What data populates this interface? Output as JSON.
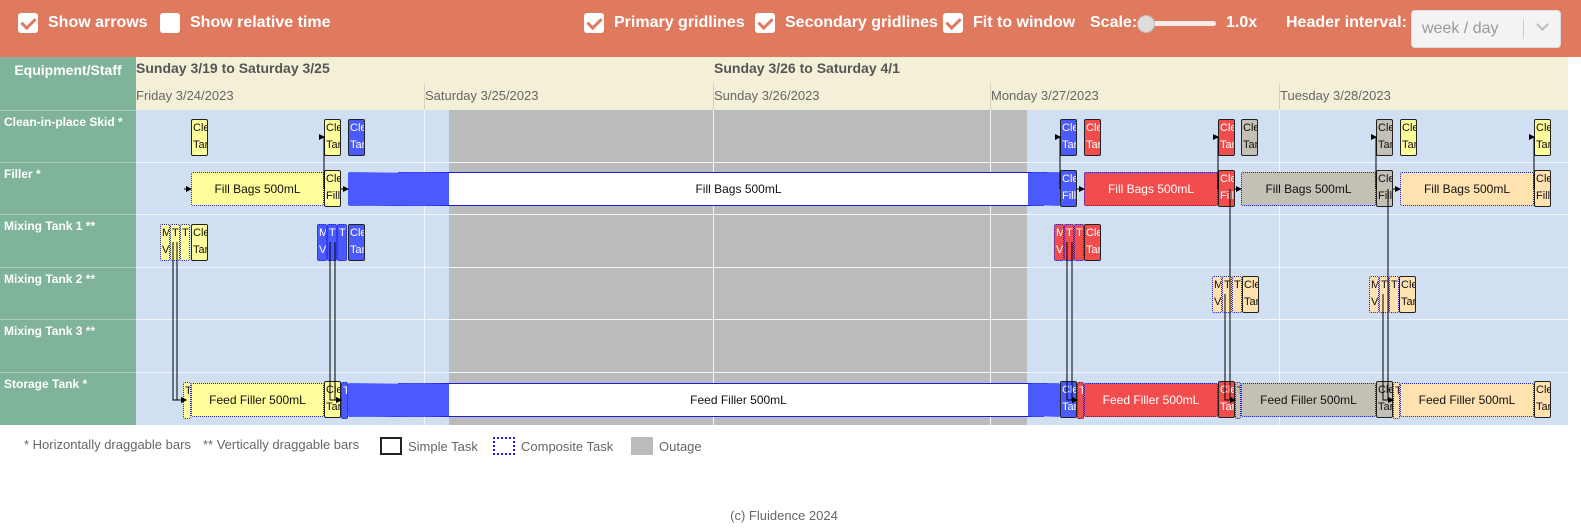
{
  "toolbar": {
    "show_arrows": {
      "label": "Show arrows",
      "checked": true
    },
    "show_relative_time": {
      "label": "Show relative time",
      "checked": false
    },
    "primary_gridlines": {
      "label": "Primary gridlines",
      "checked": true
    },
    "secondary_gridlines": {
      "label": "Secondary gridlines",
      "checked": true
    },
    "fit_to_window": {
      "label": "Fit to window",
      "checked": true
    },
    "scale_label": "Scale:",
    "scale_value": "1.0x",
    "header_interval_label": "Header interval:",
    "header_interval_value": "week / day"
  },
  "gantt": {
    "resource_header": "Equipment/Staff",
    "resources": [
      "Clean-in-place Skid *",
      "Filler *",
      "Mixing Tank 1 **",
      "Mixing Tank 2 **",
      "Mixing Tank 3 **",
      "Storage Tank *"
    ],
    "weeks": [
      "Sunday 3/19 to Saturday 3/25",
      "Sunday 3/26 to Saturday 4/1"
    ],
    "days": [
      "Friday 3/24/2023",
      "Saturday 3/25/2023",
      "Sunday 3/26/2023",
      "Monday 3/27/2023",
      "Tuesday 3/28/2023"
    ],
    "tasks": {
      "fill_bags": "Fill Bags 500mL",
      "feed_filler": "Feed Filler 500mL",
      "clean_tank": "Clean Tank",
      "clean_filler": "Clean Filler",
      "mix_vat": "Mix Vat",
      "transfer": "Transfer"
    },
    "colors": {
      "yellow": "#fffc9a",
      "blue": "#4a5aff",
      "red": "#f24c4c",
      "gray": "#c4c0b4",
      "peach": "#ffe2b0",
      "outage": "#bbbbbb"
    }
  },
  "legend": {
    "horizontal": "* Horizontally draggable bars",
    "vertical": "** Vertically draggable bars",
    "simple": "Simple Task",
    "composite": "Composite Task",
    "outage": "Outage"
  },
  "footer": "(c) Fluidence 2024"
}
